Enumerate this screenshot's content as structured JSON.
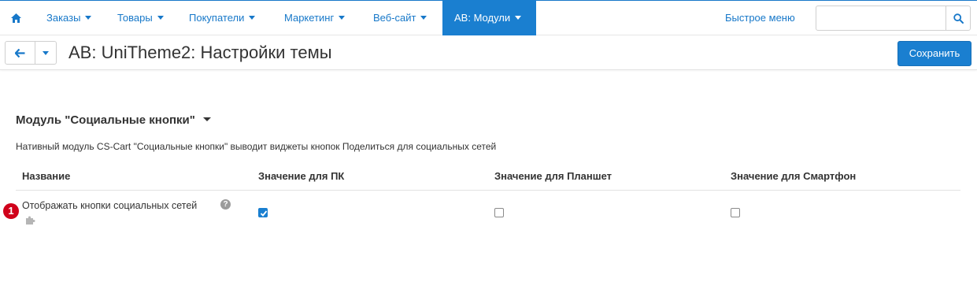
{
  "nav": {
    "home_icon": "home-icon",
    "items": [
      {
        "label": "Заказы"
      },
      {
        "label": "Товары"
      },
      {
        "label": "Покупатели"
      },
      {
        "label": "Маркетинг"
      },
      {
        "label": "Веб-сайт"
      },
      {
        "label": "AB: Модули"
      }
    ],
    "quick_menu": "Быстрое меню",
    "search": {
      "value": "",
      "placeholder": ""
    }
  },
  "toolbar": {
    "title": "AB: UniTheme2: Настройки темы",
    "save_label": "Сохранить"
  },
  "section": {
    "title": "Модуль \"Социальные кнопки\"",
    "description": "Нативный модуль CS-Cart \"Социальные кнопки\" выводит виджеты кнопок Поделиться для социальных сетей",
    "columns": [
      "Название",
      "Значение для ПК",
      "Значение для Планшет",
      "Значение для Смартфон"
    ],
    "rows": [
      {
        "label": "Отображать кнопки социальных сетей",
        "help": "?",
        "badge": "1",
        "pc": true,
        "tablet": false,
        "smartphone": false
      }
    ]
  },
  "colors": {
    "accent": "#1a7fd0",
    "link": "#1778c9",
    "badge": "#d0021b"
  }
}
